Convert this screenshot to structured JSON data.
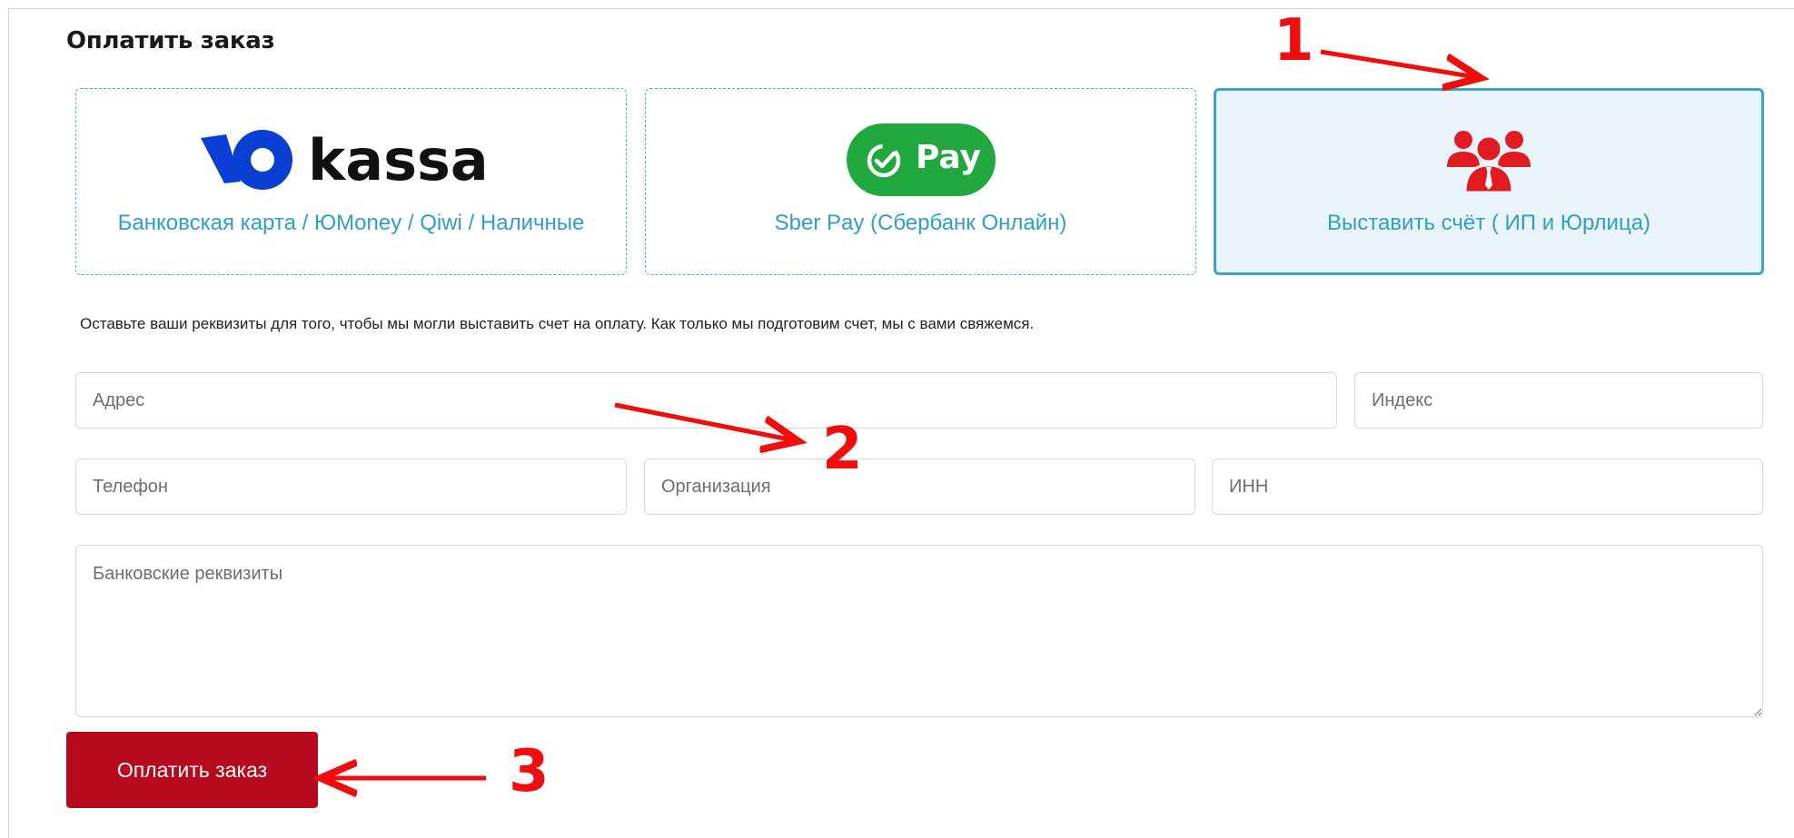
{
  "page": {
    "title": "Оплатить заказ"
  },
  "payment_methods": [
    {
      "id": "yookassa",
      "logo_text": "kassa",
      "caption": "Банковская карта / ЮMoney / Qiwi / Наличные",
      "icon": "yookassa-logo-icon",
      "selected": false
    },
    {
      "id": "sberpay",
      "logo_text": "Pay",
      "caption": "Sber Pay (Сбербанк Онлайн)",
      "icon": "sberpay-logo-icon",
      "selected": false
    },
    {
      "id": "invoice",
      "caption": "Выставить счёт ( ИП и Юрлица)",
      "icon": "people-group-icon",
      "selected": true
    }
  ],
  "note": "Оставьте ваши реквизиты для того, чтобы мы могли выставить счет на оплату. Как только мы подготовим счет, мы с вами свяжемся.",
  "form": {
    "address_placeholder": "Адрес",
    "postcode_placeholder": "Индекс",
    "phone_placeholder": "Телефон",
    "organization_placeholder": "Организация",
    "inn_placeholder": "ИНН",
    "bank_details_placeholder": "Банковские реквизиты"
  },
  "submit_label": "Оплатить заказ",
  "annotations": [
    "1",
    "2",
    "3"
  ],
  "colors": {
    "accent_blue": "#2f9fc3",
    "card_border": "#4fb3cf",
    "selected_bg": "#e9f4fa",
    "submit_bg": "#b80a1e",
    "sber_green": "#20a83f",
    "annotation_red": "#ef0d0d",
    "yoo_blue": "#0a3fd3"
  }
}
